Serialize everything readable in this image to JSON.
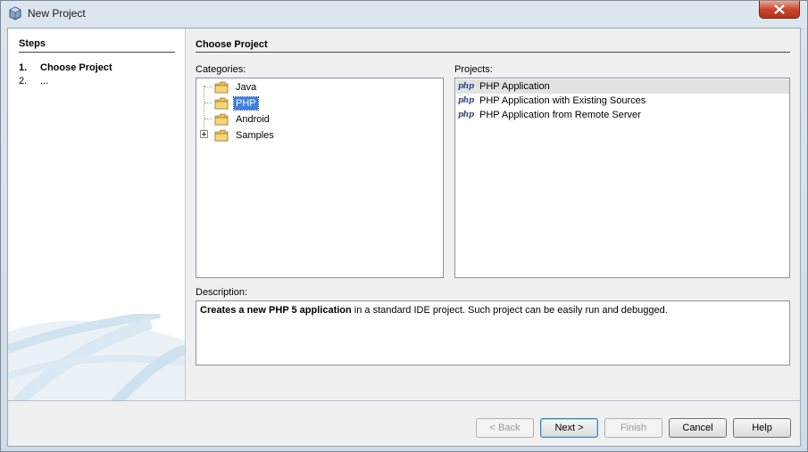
{
  "window": {
    "title": "New Project",
    "icon": "netbeans-cube-icon"
  },
  "steps": {
    "heading": "Steps",
    "items": [
      {
        "num": "1.",
        "label": "Choose Project"
      },
      {
        "num": "2.",
        "label": "..."
      }
    ]
  },
  "main": {
    "heading": "Choose Project",
    "categories_label": "Categories:",
    "projects_label": "Projects:",
    "description_label": "Description:",
    "categories": [
      {
        "label": "Java",
        "icon": "folder-icon",
        "expandable": false,
        "selected": false
      },
      {
        "label": "PHP",
        "icon": "folder-icon",
        "expandable": false,
        "selected": true
      },
      {
        "label": "Android",
        "icon": "folder-icon",
        "expandable": false,
        "selected": false
      },
      {
        "label": "Samples",
        "icon": "folder-icon",
        "expandable": true,
        "selected": false
      }
    ],
    "projects": [
      {
        "label": "PHP Application",
        "icon": "php-icon",
        "selected": true
      },
      {
        "label": "PHP Application with Existing Sources",
        "icon": "php-icon",
        "selected": false
      },
      {
        "label": "PHP Application from Remote Server",
        "icon": "php-icon",
        "selected": false
      }
    ],
    "description": {
      "bold": "Creates a new PHP 5 application",
      "rest": " in a standard IDE project. Such project can be easily run and debugged."
    }
  },
  "buttons": {
    "back": "< Back",
    "next": "Next >",
    "finish": "Finish",
    "cancel": "Cancel",
    "help": "Help"
  },
  "icons": {
    "php": "php"
  },
  "colors": {
    "selection": "#3d80df",
    "project_selection": "#e2e2e2",
    "close_button": "#c9462c"
  }
}
